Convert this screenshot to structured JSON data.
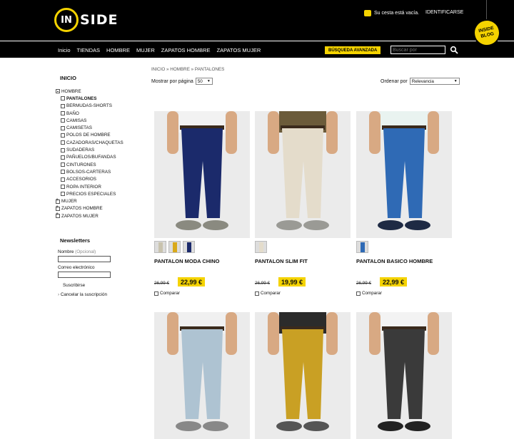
{
  "header": {
    "logo_in": "IN",
    "logo_side": "SIDE",
    "cart_text": "Su cesta está vacía.",
    "login": "IDENTIFICARSE",
    "blog_line1": "INSIDE",
    "blog_line2": "BLOG"
  },
  "nav": {
    "items": [
      "Inicio",
      "TIENDAS",
      "HOMBRE",
      "MUJER",
      "ZAPATOS HOMBRE",
      "ZAPATOS MUJER"
    ],
    "advanced_search": "BÚSQUEDA AVANZADA",
    "search_placeholder": "Buscar por"
  },
  "sidebar": {
    "home": "INICIO",
    "hombre": "HOMBRE",
    "subcategories": [
      "PANTALONES",
      "BERMUDAS-SHORTS",
      "BAÑO",
      "CAMISAS",
      "CAMISETAS",
      "POLOS DE HOMBRE",
      "CAZADORAS/CHAQUETAS",
      "SUDADERAS",
      "PAÑUELOS/BUFANDAS",
      "CINTURONES",
      "BOLSOS-CARTERAS",
      "ACCESORIOS",
      "ROPA INTERIOR",
      "PRECIOS ESPECIALES"
    ],
    "others": [
      "MUJER",
      "ZAPATOS HOMBRE",
      "ZAPATOS MUJER"
    ]
  },
  "newsletter": {
    "title": "Newsletters",
    "name_label": "Nombre",
    "optional": "(Opcional)",
    "email_label": "Correo electrónico",
    "subscribe": "Suscribirse",
    "cancel": "Cancelar la suscripción"
  },
  "toolbar": {
    "breadcrumb": {
      "home": "INICIO",
      "sep": "»",
      "cat": "HOMBRE",
      "current": "PANTALONES"
    },
    "per_page_label": "Mostrar por página",
    "per_page_value": "50",
    "order_label": "Ordenar por",
    "order_value": "Relevancia"
  },
  "products": [
    {
      "name": "PANTALON MODA CHINO",
      "old_price": "26,99 €",
      "new_price": "22,99 €",
      "compare": "Comparar",
      "pants_color": "#1b2a6b",
      "shirt_color": "#f2f2f2",
      "shoe_color": "#8a8a80",
      "thumbs": [
        "#c9c3ae",
        "#d9a91a",
        "#1b2a6b"
      ]
    },
    {
      "name": "PANTALON SLIM FIT",
      "old_price": "26,99 €",
      "new_price": "19,99 €",
      "compare": "Comparar",
      "pants_color": "#e4dccb",
      "shirt_color": "#6b5b3a",
      "shoe_color": "#9a9a95",
      "thumbs": [
        "#e4dccb"
      ]
    },
    {
      "name": "PANTALON BASICO HOMBRE",
      "old_price": "26,99 €",
      "new_price": "22,99 €",
      "compare": "Comparar",
      "pants_color": "#2f6ab5",
      "shirt_color": "#e9f3f0",
      "shoe_color": "#1e2a44",
      "thumbs": [
        "#2f6ab5"
      ]
    },
    {
      "pants_color": "#aec3d2",
      "shirt_color": "#f0f0f0",
      "shoe_color": "#888888"
    },
    {
      "pants_color": "#c9a024",
      "shirt_color": "#2b2b2b",
      "shoe_color": "#555555"
    },
    {
      "pants_color": "#3a3a3a",
      "shirt_color": "#f3f3f3",
      "shoe_color": "#222222"
    }
  ],
  "colors": {
    "accent": "#f5d300",
    "header_bg": "#000000"
  }
}
